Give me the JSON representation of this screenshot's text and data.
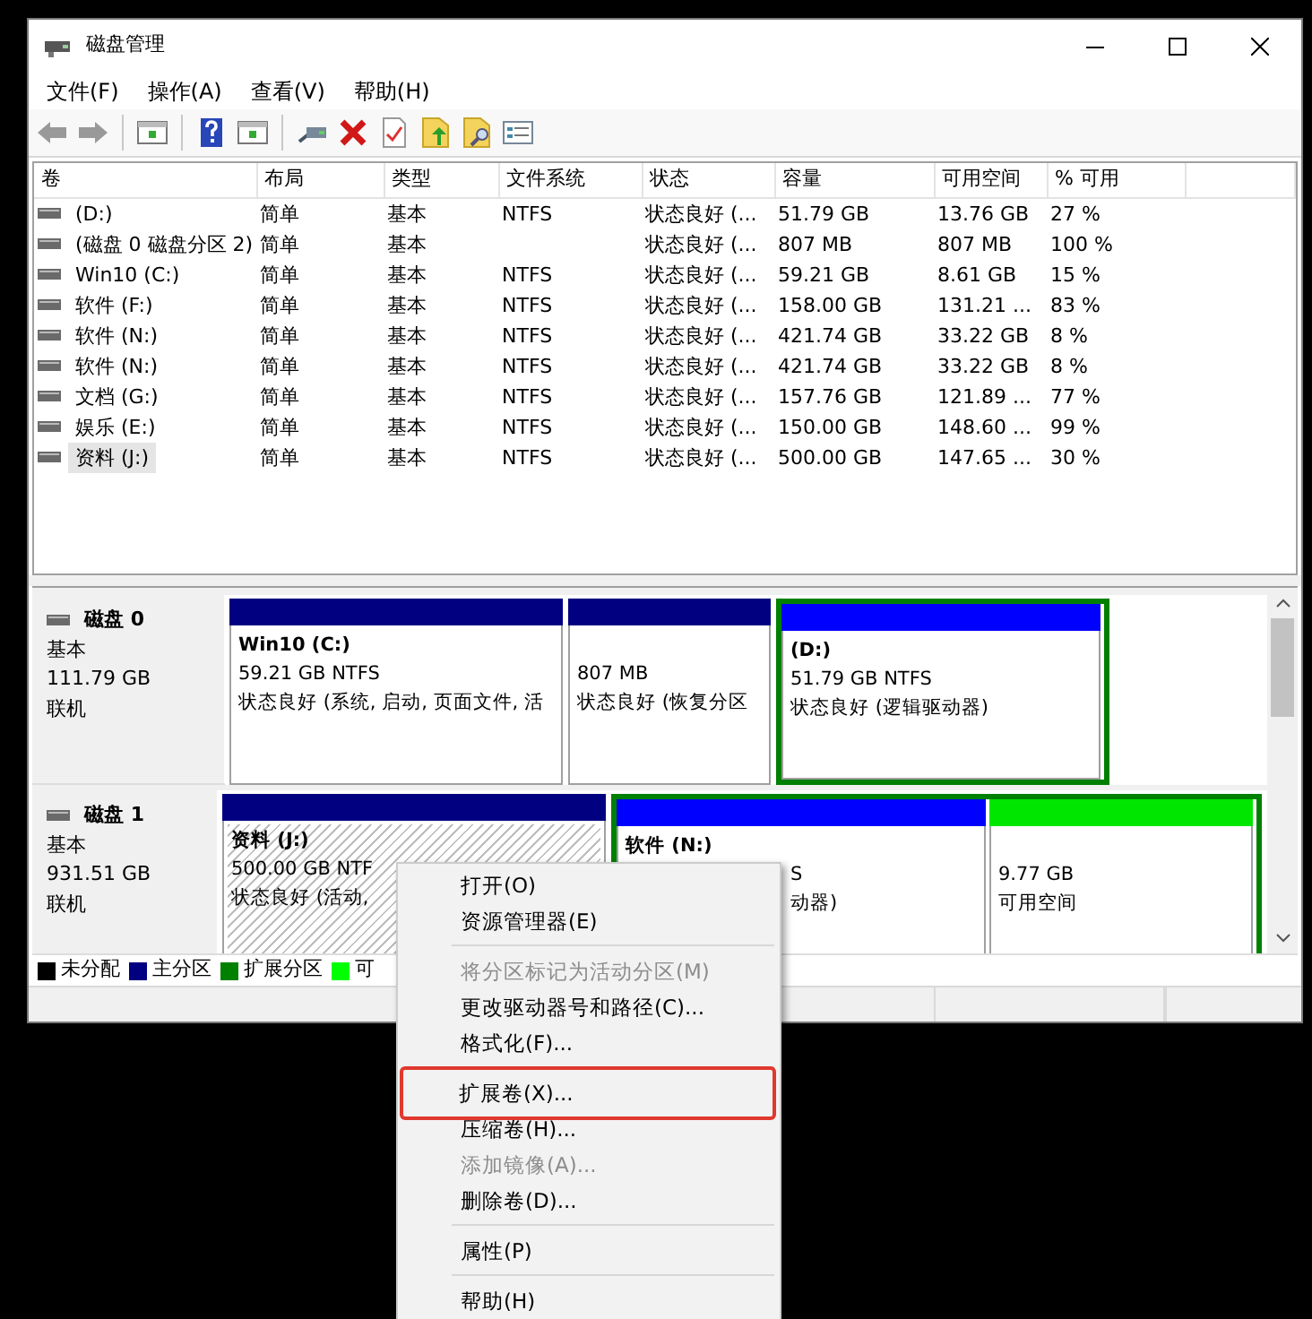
{
  "window": {
    "title": "磁盘管理"
  },
  "menu_bar": [
    "文件(F)",
    "操作(A)",
    "查看(V)",
    "帮助(H)"
  ],
  "volume_table": {
    "columns": [
      "卷",
      "布局",
      "类型",
      "文件系统",
      "状态",
      "容量",
      "可用空间",
      "% 可用"
    ],
    "rows": [
      {
        "cells": [
          " (D:)",
          "简单",
          "基本",
          "NTFS",
          "状态良好 (...",
          "51.79 GB",
          "13.76 GB",
          "27 %"
        ],
        "selected": false
      },
      {
        "cells": [
          "(磁盘 0 磁盘分区 2)",
          "简单",
          "基本",
          "",
          "状态良好 (...",
          "807 MB",
          "807 MB",
          "100 %"
        ],
        "selected": false
      },
      {
        "cells": [
          "Win10 (C:)",
          "简单",
          "基本",
          "NTFS",
          "状态良好 (...",
          "59.21 GB",
          "8.61 GB",
          "15 %"
        ],
        "selected": false
      },
      {
        "cells": [
          "软件 (F:)",
          "简单",
          "基本",
          "NTFS",
          "状态良好 (...",
          "158.00 GB",
          "131.21 ...",
          "83 %"
        ],
        "selected": false
      },
      {
        "cells": [
          "软件 (N:)",
          "简单",
          "基本",
          "NTFS",
          "状态良好 (...",
          "421.74 GB",
          "33.22 GB",
          "8 %"
        ],
        "selected": false
      },
      {
        "cells": [
          "软件 (N:)",
          "简单",
          "基本",
          "NTFS",
          "状态良好 (...",
          "421.74 GB",
          "33.22 GB",
          "8 %"
        ],
        "selected": false
      },
      {
        "cells": [
          "文档 (G:)",
          "简单",
          "基本",
          "NTFS",
          "状态良好 (...",
          "157.76 GB",
          "121.89 ...",
          "77 %"
        ],
        "selected": false
      },
      {
        "cells": [
          "娱乐 (E:)",
          "简单",
          "基本",
          "NTFS",
          "状态良好 (...",
          "150.00 GB",
          "148.60 ...",
          "99 %"
        ],
        "selected": false
      },
      {
        "cells": [
          "资料 (J:)",
          "简单",
          "基本",
          "NTFS",
          "状态良好 (...",
          "500.00 GB",
          "147.65 ...",
          "30 %"
        ],
        "selected": true
      }
    ]
  },
  "disks": [
    {
      "name": "磁盘 0",
      "type": "基本",
      "size": "111.79 GB",
      "status": "联机",
      "partitions": [
        {
          "kind": "primary",
          "name": "Win10  (C:)",
          "lines": [
            "59.21 GB NTFS",
            "状态良好 (系统, 启动, 页面文件, 活"
          ],
          "selected": false
        },
        {
          "kind": "primary",
          "lines": [
            "807 MB",
            "状态良好 (恢复分区"
          ],
          "selected": false
        },
        {
          "kind": "logical",
          "name": "(D:)",
          "lines": [
            "51.79 GB NTFS",
            "状态良好 (逻辑驱动器)"
          ],
          "selected": false
        }
      ]
    },
    {
      "name": "磁盘 1",
      "type": "基本",
      "size": "931.51 GB",
      "status": "联机",
      "partitions": [
        {
          "kind": "primary",
          "name": "资料  (J:)",
          "lines": [
            "500.00 GB NTF",
            "状态良好 (活动,"
          ],
          "selected": true
        },
        {
          "kind": "logical",
          "name": "软件  (N:)",
          "lines": [
            "S",
            "动器)"
          ],
          "covered_left": true,
          "selected": false
        },
        {
          "kind": "free",
          "lines": [
            "9.77 GB",
            "可用空间"
          ],
          "selected": false
        }
      ]
    }
  ],
  "legend": [
    {
      "label": "未分配",
      "color": "#000000"
    },
    {
      "label": "主分区",
      "color": "#000080"
    },
    {
      "label": "扩展分区",
      "color": "#008000"
    },
    {
      "label": "可",
      "color": "#00ff00"
    }
  ],
  "context_menu": [
    {
      "kind": "item",
      "label": "打开(O)",
      "disabled": false,
      "highlighted": false
    },
    {
      "kind": "item",
      "label": "资源管理器(E)",
      "disabled": false,
      "highlighted": false
    },
    {
      "kind": "separator"
    },
    {
      "kind": "item",
      "label": "将分区标记为活动分区(M)",
      "disabled": true,
      "highlighted": false
    },
    {
      "kind": "item",
      "label": "更改驱动器号和路径(C)...",
      "disabled": false,
      "highlighted": false
    },
    {
      "kind": "item",
      "label": "格式化(F)...",
      "disabled": false,
      "highlighted": false
    },
    {
      "kind": "separator"
    },
    {
      "kind": "item",
      "label": "扩展卷(X)...",
      "disabled": false,
      "highlighted": true
    },
    {
      "kind": "item",
      "label": "压缩卷(H)...",
      "disabled": false,
      "highlighted": false
    },
    {
      "kind": "item",
      "label": "添加镜像(A)...",
      "disabled": true,
      "highlighted": false
    },
    {
      "kind": "item",
      "label": "删除卷(D)...",
      "disabled": false,
      "highlighted": false
    },
    {
      "kind": "separator"
    },
    {
      "kind": "item",
      "label": "属性(P)",
      "disabled": false,
      "highlighted": false
    },
    {
      "kind": "separator"
    },
    {
      "kind": "item",
      "label": "帮助(H)",
      "disabled": false,
      "highlighted": false
    }
  ]
}
